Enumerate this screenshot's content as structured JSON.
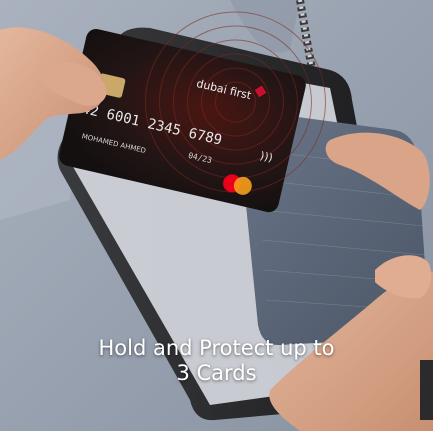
{
  "card": {
    "brand": "dubai first",
    "number_line_1": "42 6001 2345 6789",
    "good_thru": "04/23",
    "holder": "MOHAMED AHMED"
  },
  "caption": {
    "line1": "Hold and Protect up to",
    "line2": "3 Cards"
  },
  "colors": {
    "shirt": "#9ea7b5",
    "fabric_pocket": "#556273",
    "card_base": "#1b1414",
    "card_accent": "#c8102e",
    "phone_frame": "#2a2a2c"
  }
}
